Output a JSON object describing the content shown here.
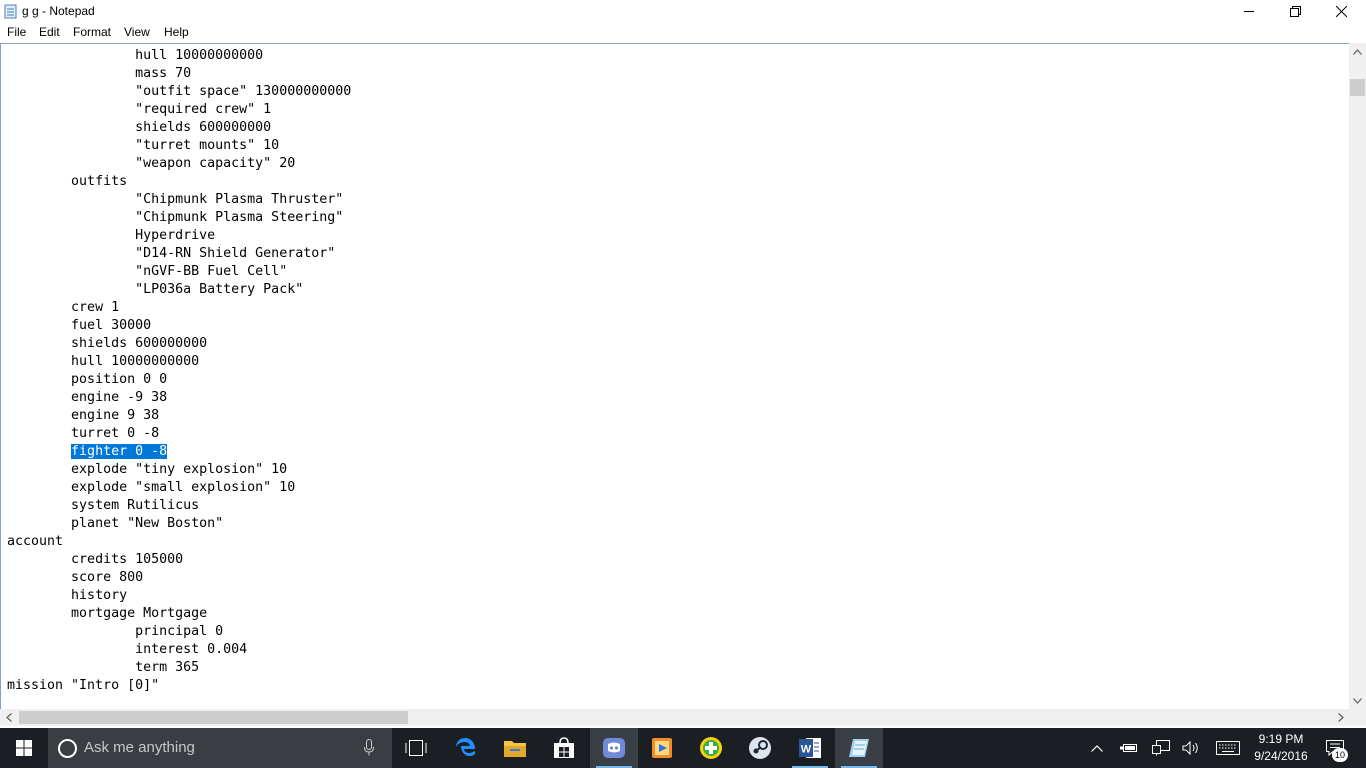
{
  "window": {
    "title": "g g - Notepad"
  },
  "menu": {
    "file": "File",
    "edit": "Edit",
    "format": "Format",
    "view": "View",
    "help": "Help"
  },
  "editor": {
    "lines": [
      {
        "indent": "\t\t",
        "text": "hull 10000000000"
      },
      {
        "indent": "\t\t",
        "text": "mass 70"
      },
      {
        "indent": "\t\t",
        "text": "\"outfit space\" 130000000000"
      },
      {
        "indent": "\t\t",
        "text": "\"required crew\" 1"
      },
      {
        "indent": "\t\t",
        "text": "shields 600000000"
      },
      {
        "indent": "\t\t",
        "text": "\"turret mounts\" 10"
      },
      {
        "indent": "\t\t",
        "text": "\"weapon capacity\" 20"
      },
      {
        "indent": "\t",
        "text": "outfits"
      },
      {
        "indent": "\t\t",
        "text": "\"Chipmunk Plasma Thruster\""
      },
      {
        "indent": "\t\t",
        "text": "\"Chipmunk Plasma Steering\""
      },
      {
        "indent": "\t\t",
        "text": "Hyperdrive"
      },
      {
        "indent": "\t\t",
        "text": "\"D14-RN Shield Generator\""
      },
      {
        "indent": "\t\t",
        "text": "\"nGVF-BB Fuel Cell\""
      },
      {
        "indent": "\t\t",
        "text": "\"LP036a Battery Pack\""
      },
      {
        "indent": "\t",
        "text": "crew 1"
      },
      {
        "indent": "\t",
        "text": "fuel 30000"
      },
      {
        "indent": "\t",
        "text": "shields 600000000"
      },
      {
        "indent": "\t",
        "text": "hull 10000000000"
      },
      {
        "indent": "\t",
        "text": "position 0 0"
      },
      {
        "indent": "\t",
        "text": "engine -9 38"
      },
      {
        "indent": "\t",
        "text": "engine 9 38"
      },
      {
        "indent": "\t",
        "text": "turret 0 -8"
      },
      {
        "indent": "\t",
        "text": "fighter 0 -8",
        "selected": true
      },
      {
        "indent": "\t",
        "text": "explode \"tiny explosion\" 10"
      },
      {
        "indent": "\t",
        "text": "explode \"small explosion\" 10"
      },
      {
        "indent": "\t",
        "text": "system Rutilicus"
      },
      {
        "indent": "\t",
        "text": "planet \"New Boston\""
      },
      {
        "indent": "",
        "text": "account"
      },
      {
        "indent": "\t",
        "text": "credits 105000"
      },
      {
        "indent": "\t",
        "text": "score 800"
      },
      {
        "indent": "\t",
        "text": "history"
      },
      {
        "indent": "\t",
        "text": "mortgage Mortgage"
      },
      {
        "indent": "\t\t",
        "text": "principal 0"
      },
      {
        "indent": "\t\t",
        "text": "interest 0.004"
      },
      {
        "indent": "\t\t",
        "text": "term 365"
      },
      {
        "indent": "",
        "text": "mission \"Intro [0]\""
      }
    ]
  },
  "taskbar": {
    "search_placeholder": "Ask me anything",
    "apps": [
      "task-view",
      "edge",
      "file-explorer",
      "store",
      "discord",
      "media-player",
      "plus-app",
      "steam",
      "word",
      "notepad"
    ],
    "time": "9:19 PM",
    "date": "9/24/2016",
    "notification_count": "10"
  },
  "colors": {
    "selection": "#0078d7",
    "taskbar": "#1b1f24",
    "accent": "#76b9ed"
  }
}
